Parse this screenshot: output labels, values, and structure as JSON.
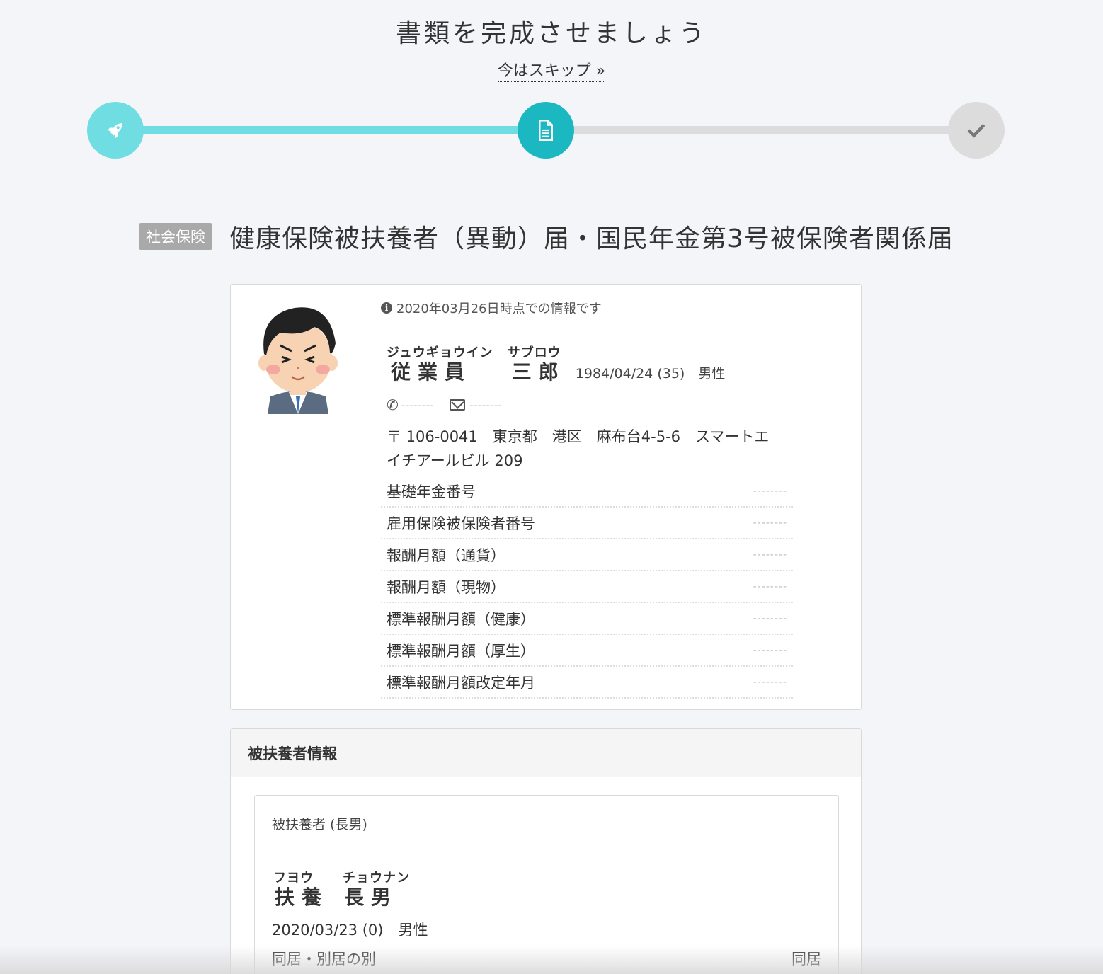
{
  "header": {
    "title": "書類を完成させましょう",
    "skip_label": "今はスキップ »"
  },
  "progress": {
    "steps": [
      {
        "icon": "rocket-icon",
        "state": "done"
      },
      {
        "icon": "document-icon",
        "state": "current"
      },
      {
        "icon": "checkmark-icon",
        "state": "todo"
      }
    ]
  },
  "form": {
    "category": "社会保険",
    "title": "健康保険被扶養者（異動）届・国民年金第3号被保険者関係届"
  },
  "employee": {
    "info_note": "2020年03月26日時点での情報です",
    "family_kana": "ジュウギョウイン",
    "family_kanji": "従業員",
    "given_kana": "サブロウ",
    "given_kanji": "三郎",
    "birth_info": "1984/04/24 (35)　男性",
    "phone": "--------",
    "email": "--------",
    "address_line1": "〒 106-0041　東京都　港区　麻布台4-5-6　スマートエ",
    "address_line2": "イチアールビル 209",
    "fields": [
      {
        "label": "基礎年金番号",
        "value": "--------"
      },
      {
        "label": "雇用保険被保険者番号",
        "value": "--------"
      },
      {
        "label": "報酬月額（通貨）",
        "value": "--------"
      },
      {
        "label": "報酬月額（現物）",
        "value": "--------"
      },
      {
        "label": "標準報酬月額（健康）",
        "value": "--------"
      },
      {
        "label": "標準報酬月額（厚生）",
        "value": "--------"
      },
      {
        "label": "標準報酬月額改定年月",
        "value": "--------"
      }
    ]
  },
  "dependents": {
    "section_title": "被扶養者情報",
    "items": [
      {
        "label": "被扶養者 (長男)",
        "family_kana": "フヨウ",
        "family_kanji": "扶養",
        "given_kana": "チョウナン",
        "given_kanji": "長男",
        "birth_info": "2020/03/23 (0)　男性",
        "fields": [
          {
            "label": "同居・別居の別",
            "value": "同居"
          }
        ]
      }
    ]
  },
  "colors": {
    "accent": "#1bb8c1",
    "accent_light": "#6fdde2",
    "inactive": "#dcdcdc",
    "badge": "#a9a9a9"
  }
}
